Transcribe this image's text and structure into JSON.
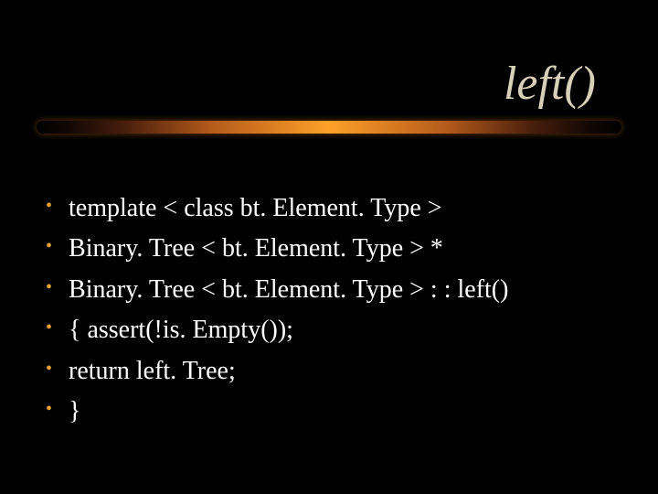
{
  "title": "left()",
  "bullets": [
    "template < class bt. Element. Type >",
    "Binary. Tree < bt. Element. Type > *",
    "Binary. Tree < bt. Element. Type > : : left()",
    "{ assert(!is. Empty());",
    "   return left. Tree;",
    "}"
  ]
}
